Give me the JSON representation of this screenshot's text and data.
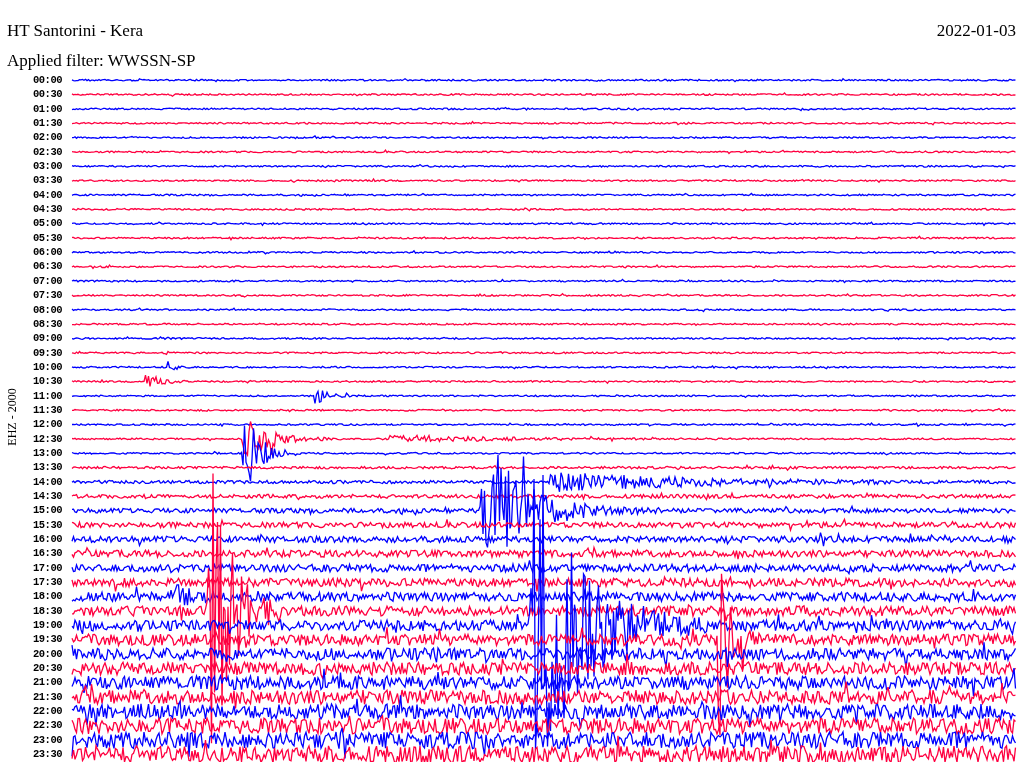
{
  "header": {
    "station": "HT Santorini - Kera",
    "date": "2022-01-03",
    "filter": "Applied filter: WWSSN-SP"
  },
  "axis_label": "EHZ - 2000",
  "rows": [
    {
      "time": "00:00",
      "color": "#0000ff"
    },
    {
      "time": "00:30",
      "color": "#ff0040"
    },
    {
      "time": "01:00",
      "color": "#0000ff"
    },
    {
      "time": "01:30",
      "color": "#ff0040"
    },
    {
      "time": "02:00",
      "color": "#0000ff"
    },
    {
      "time": "02:30",
      "color": "#ff0040"
    },
    {
      "time": "03:00",
      "color": "#0000ff"
    },
    {
      "time": "03:30",
      "color": "#ff0040"
    },
    {
      "time": "04:00",
      "color": "#0000ff"
    },
    {
      "time": "04:30",
      "color": "#ff0040"
    },
    {
      "time": "05:00",
      "color": "#0000ff"
    },
    {
      "time": "05:30",
      "color": "#ff0040"
    },
    {
      "time": "06:00",
      "color": "#0000ff"
    },
    {
      "time": "06:30",
      "color": "#ff0040"
    },
    {
      "time": "07:00",
      "color": "#0000ff"
    },
    {
      "time": "07:30",
      "color": "#ff0040"
    },
    {
      "time": "08:00",
      "color": "#0000ff"
    },
    {
      "time": "08:30",
      "color": "#ff0040"
    },
    {
      "time": "09:00",
      "color": "#0000ff"
    },
    {
      "time": "09:30",
      "color": "#ff0040"
    },
    {
      "time": "10:00",
      "color": "#0000ff"
    },
    {
      "time": "10:30",
      "color": "#ff0040"
    },
    {
      "time": "11:00",
      "color": "#0000ff"
    },
    {
      "time": "11:30",
      "color": "#ff0040"
    },
    {
      "time": "12:00",
      "color": "#0000ff"
    },
    {
      "time": "12:30",
      "color": "#ff0040"
    },
    {
      "time": "13:00",
      "color": "#0000ff"
    },
    {
      "time": "13:30",
      "color": "#ff0040"
    },
    {
      "time": "14:00",
      "color": "#0000ff"
    },
    {
      "time": "14:30",
      "color": "#ff0040"
    },
    {
      "time": "15:00",
      "color": "#0000ff"
    },
    {
      "time": "15:30",
      "color": "#ff0040"
    },
    {
      "time": "16:00",
      "color": "#0000ff"
    },
    {
      "time": "16:30",
      "color": "#ff0040"
    },
    {
      "time": "17:00",
      "color": "#0000ff"
    },
    {
      "time": "17:30",
      "color": "#ff0040"
    },
    {
      "time": "18:00",
      "color": "#0000ff"
    },
    {
      "time": "18:30",
      "color": "#ff0040"
    },
    {
      "time": "19:00",
      "color": "#0000ff"
    },
    {
      "time": "19:30",
      "color": "#ff0040"
    },
    {
      "time": "20:00",
      "color": "#0000ff"
    },
    {
      "time": "20:30",
      "color": "#ff0040"
    },
    {
      "time": "21:00",
      "color": "#0000ff"
    },
    {
      "time": "21:30",
      "color": "#ff0040"
    },
    {
      "time": "22:00",
      "color": "#0000ff"
    },
    {
      "time": "22:30",
      "color": "#ff0040"
    },
    {
      "time": "23:00",
      "color": "#0000ff"
    },
    {
      "time": "23:30",
      "color": "#ff0040"
    }
  ]
}
